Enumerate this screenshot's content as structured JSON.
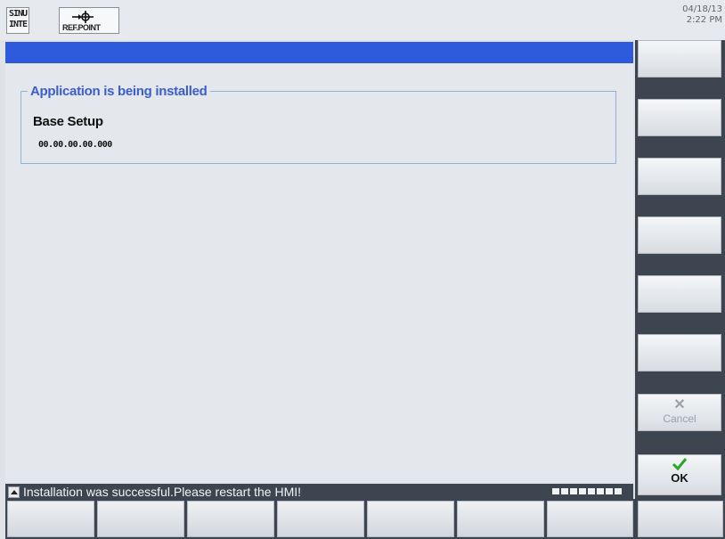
{
  "header": {
    "logo_text": "SINU\nINTE",
    "refpoint_label": "REF.POINT",
    "date": "04/18/13",
    "time": "2:22 PM"
  },
  "dialog": {
    "group_title": "Application is being installed",
    "app_name": "Base Setup",
    "app_version": "00.00.00.00.000"
  },
  "status": {
    "message": "Installation was successful.Please restart the HMI!",
    "progress_segments": 8
  },
  "softkeys": {
    "vertical": [
      "",
      "",
      "",
      "",
      "",
      "",
      "Cancel",
      "OK"
    ],
    "horizontal": [
      "",
      "",
      "",
      "",
      "",
      "",
      "",
      ""
    ]
  },
  "colors": {
    "title_bar": "#2d5bdc",
    "accent_text": "#3a5ed4",
    "softkey_frame": "#3d4650",
    "ok_check": "#2aa62a"
  }
}
